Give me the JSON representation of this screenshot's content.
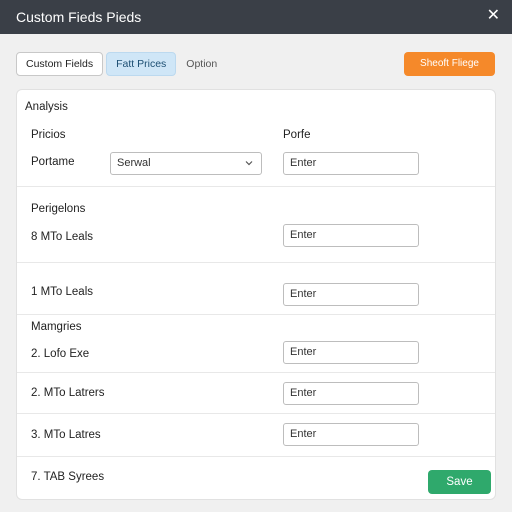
{
  "window": {
    "title": "Custom Fieds Pieds"
  },
  "tabs": [
    {
      "label": "Custom Fields"
    },
    {
      "label": "Fatt Prices"
    },
    {
      "label": "Option"
    }
  ],
  "header_button": {
    "label": "Sheoft Fliege"
  },
  "panel": {
    "section_title": "Analysis",
    "prices_label": "Pricios",
    "porte_label": "Porfe",
    "portame_label": "Portame",
    "select_value": "Serwal",
    "porte_input_placeholder": "Enter",
    "perigelons_title": "Perigelons",
    "rows": [
      {
        "label": "8  MTo Leals",
        "placeholder": "Enter"
      },
      {
        "label": "1  MTo Leals",
        "placeholder": "Enter"
      }
    ],
    "mamgries_title": "Mamgries",
    "rows2": [
      {
        "label": "2.  Lofo Exe",
        "placeholder": "Enter"
      },
      {
        "label": "2.  MTo Latrers",
        "placeholder": "Enter"
      },
      {
        "label": "3.  MTo Latres",
        "placeholder": "Enter"
      }
    ],
    "footer_label": "7.  TAB Syrees",
    "save_label": "Save"
  },
  "colors": {
    "titlebar": "#3a3f47",
    "accent_orange": "#f5892a",
    "accent_green": "#2fa96c",
    "tab_active": "#cfe6f7"
  },
  "icons": {
    "close": "close-icon",
    "dropdown": "chevron-down-icon"
  }
}
